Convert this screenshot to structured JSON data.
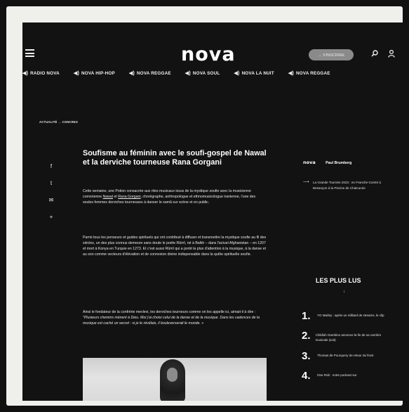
{
  "header": {
    "logo": "nova",
    "subscribe_label": "→ S'INSCRIRE"
  },
  "nav": {
    "wave_glyph": "◀)",
    "items": [
      "RADIO NOVA",
      "NOVA HIP-HOP",
      "NOVA REGGAE",
      "NOVA SOUL",
      "NOVA LA NUIT",
      "NOVA REGGAE"
    ]
  },
  "breadcrumb": "ACTUALITÉ → CONCRES",
  "share": {
    "facebook": "f",
    "twitter": "t",
    "email": "✉",
    "more": "+"
  },
  "article": {
    "title": "Soufisme au féminin avec le soufi-gospel de Nawal et la derviche tourneuse Rana Gorgani",
    "p1_a": "Cette semaine, une Potion consacrée aux rites musicaux issus de la mystique soufie avec la musicienne comorienne ",
    "p1_link1": "Nawal",
    "p1_b": " et ",
    "p1_link2": "Rana Gorgani",
    "p1_c": ", chorégraphe, anthropologue et ethnomusicologue iranienne, l'une des seules femmes derviches tourneuses à danser le samâ sur scène et en public.",
    "p2": "Parmi tous les penseurs et guides spirituels qui ont contribué à diffuser et transmettre la mystique soufie au fil des siècles, un des plus connus demeure sans doute le poète Rûmî, né à Balkh – dans l'actuel Afghanistan – en 1207 et mort à Konya en Turquie en 1273. Et c'est aussi Rûmî qui a porté la plus d'attention à la musique, à la danse et au son comme vecteurs d'élévation et de connexion divine indispensable dans la quête spirituelle soufie.",
    "p3_normal": "Ainsi le fondateur de la confrérie mevlevi, les derviches tourneurs comme on les appelle ici, aimait-il à dire : ",
    "p3_italic": "\"Plusieurs chemins mènent à Dieu. Moi j'ai choisi celui de la danse et de la musique. Dans les cadences de la musique est caché un secret : si je le révélais, il bouleverserait le monde. »"
  },
  "sidebar": {
    "author_logo": "nova",
    "author_name": "Paul Brumberg",
    "related_arrow": "⟶",
    "related_text": "La Grande Tournée 2023 : en Franche-Comté à Besançon à la Piscine de Chalcurule",
    "popular_title": "LES PLUS LUS",
    "popular_arrow": "↓",
    "popular": [
      {
        "num": "1.",
        "text": "YG Marley : après un milliard de streams, le clip"
      },
      {
        "num": "2.",
        "text": "Childish Gambino annonce la fin de sa carrière musicale (soit)"
      },
      {
        "num": "3.",
        "text": "Thomas de Pourquery de retour du front"
      },
      {
        "num": "4.",
        "text": "One Rob : notre podcast sur"
      }
    ]
  }
}
